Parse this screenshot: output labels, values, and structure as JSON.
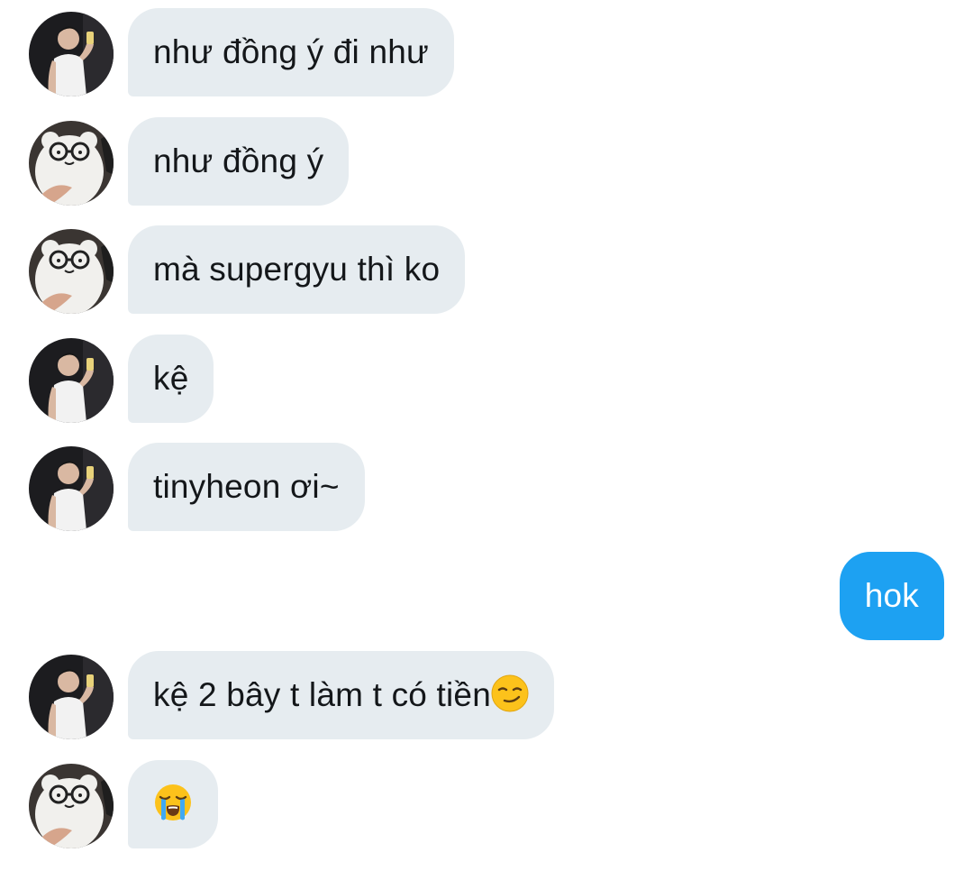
{
  "thread": {
    "messages": [
      {
        "sender": "guy-mirror-selfie",
        "direction": "incoming",
        "text": "như đồng ý đi như"
      },
      {
        "sender": "bear-plush-glasses",
        "direction": "incoming",
        "text": "như đồng ý"
      },
      {
        "sender": "bear-plush-glasses",
        "direction": "incoming",
        "text": "mà supergyu thì ko"
      },
      {
        "sender": "guy-mirror-selfie",
        "direction": "incoming",
        "text": "kệ"
      },
      {
        "sender": "guy-mirror-selfie",
        "direction": "incoming",
        "text": "tinyheon ơi~"
      },
      {
        "sender": "me",
        "direction": "outgoing",
        "text": "hok"
      },
      {
        "sender": "guy-mirror-selfie",
        "direction": "incoming",
        "text": "kệ 2 bây t làm t có tiền",
        "emoji": "smirking-face-emoji"
      },
      {
        "sender": "bear-plush-glasses",
        "direction": "incoming",
        "text": "",
        "emoji": "loudly-crying-face-emoji"
      }
    ]
  },
  "colors": {
    "incoming_bubble": "#e6ecf0",
    "outgoing_bubble": "#1da1f2",
    "incoming_text": "#14171a",
    "outgoing_text": "#ffffff",
    "background": "#ffffff"
  }
}
